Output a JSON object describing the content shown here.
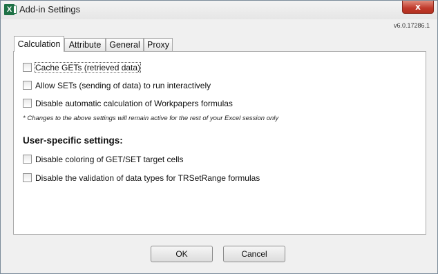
{
  "window": {
    "title": "Add-in Settings",
    "app_icon_letter": "X",
    "close_symbol": "x",
    "version": "v6.0.17286.1"
  },
  "tabs": [
    {
      "label": "Calculation",
      "active": true
    },
    {
      "label": "Attribute",
      "active": false
    },
    {
      "label": "General",
      "active": false
    },
    {
      "label": "Proxy",
      "active": false
    }
  ],
  "calculation": {
    "options": [
      {
        "label": "Cache GETs (retrieved data)",
        "checked": false
      },
      {
        "label": "Allow SETs (sending of data) to run interactively",
        "checked": false
      },
      {
        "label": "Disable automatic calculation of Workpapers formulas",
        "checked": false
      }
    ],
    "note": "*  Changes to the above settings will remain active for the rest of your Excel session only",
    "user_heading": "User-specific settings:",
    "user_options": [
      {
        "label": "Disable coloring of GET/SET target cells",
        "checked": false
      },
      {
        "label": "Disable the validation of data types for TRSetRange formulas",
        "checked": false
      }
    ]
  },
  "buttons": {
    "ok": "OK",
    "cancel": "Cancel"
  }
}
